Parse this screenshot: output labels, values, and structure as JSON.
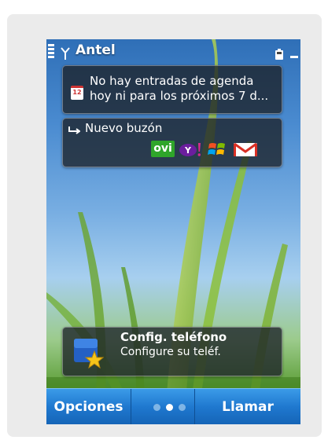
{
  "status_bar": {
    "operator": "Antel",
    "icons": [
      "signal-strength-icon",
      "antenna-icon",
      "battery-icon",
      "minimize-icon"
    ]
  },
  "widgets": {
    "agenda": {
      "icon": "calendar-icon",
      "icon_day": "12",
      "line1": "No hay entradas de agenda",
      "line2": "hoy ni para los próximos 7 d..."
    },
    "mail": {
      "icon": "mail-arrow-icon",
      "title": "Nuevo buzón",
      "providers": [
        {
          "name": "ovi-logo",
          "text": "ovi",
          "color": "#2fa52a"
        },
        {
          "name": "yahoo-logo",
          "color": "#6b1e9e"
        },
        {
          "name": "windows-logo"
        },
        {
          "name": "gmail-logo",
          "color": "#d93025"
        }
      ]
    },
    "config": {
      "icon": "config-star-icon",
      "title": "Config. teléfono",
      "subtitle": "Configure su teléf."
    }
  },
  "softkeys": {
    "left": "Opciones",
    "right": "Llamar",
    "pages": 3,
    "active_page": 2
  },
  "colors": {
    "softbar": "#1f78cf",
    "widget_bg": "#1c2128"
  }
}
